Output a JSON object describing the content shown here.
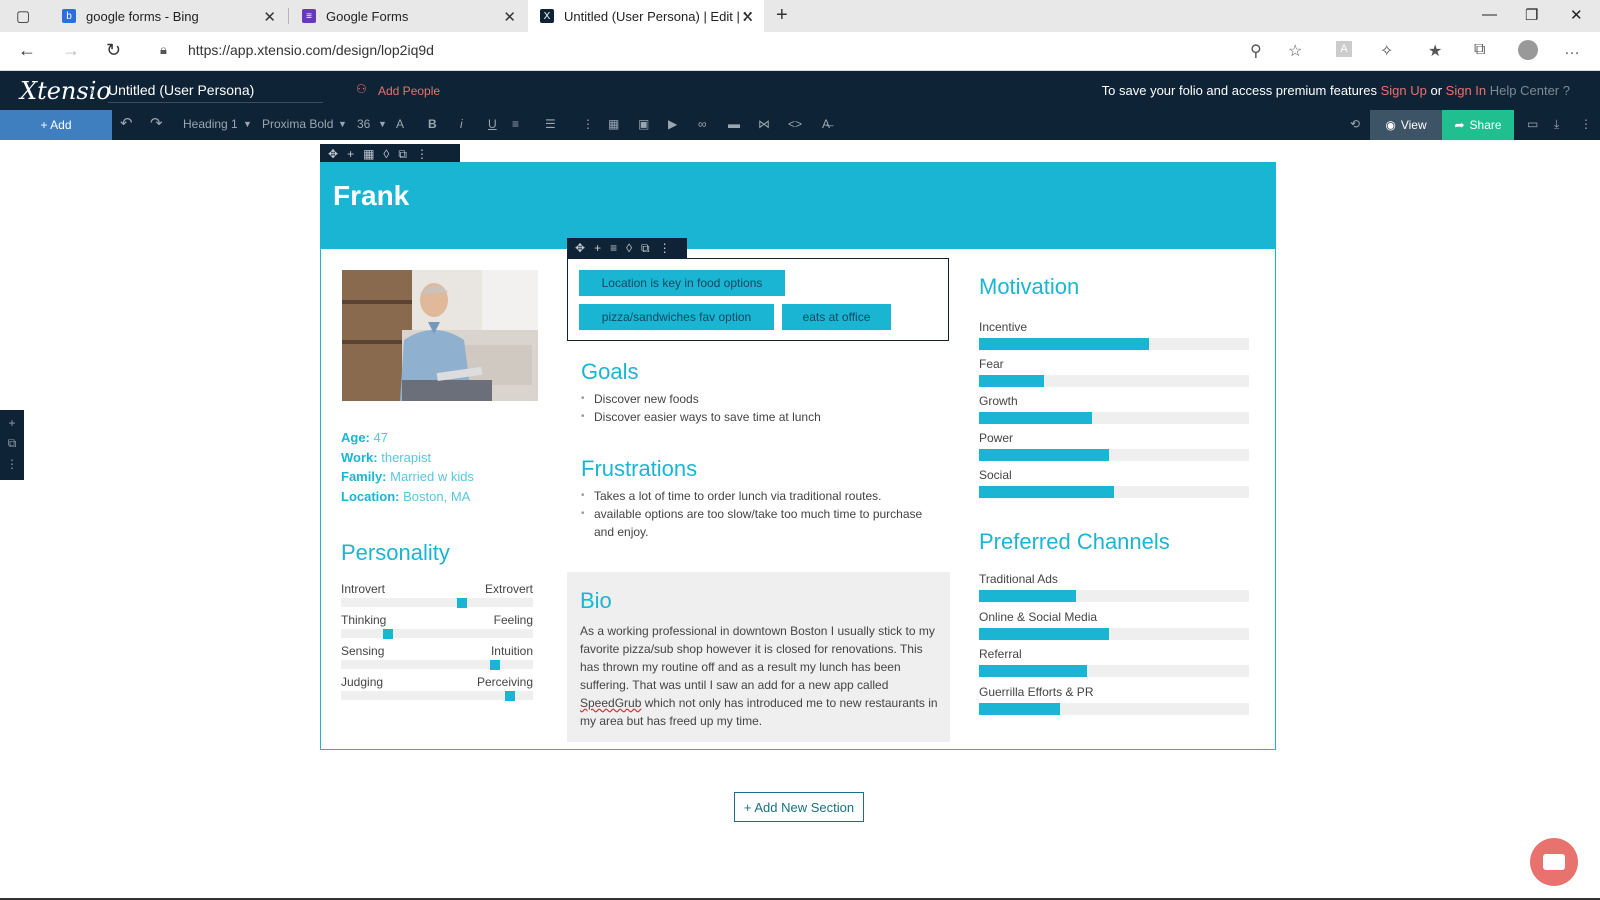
{
  "browser": {
    "tabs": [
      {
        "title": "google forms - Bing",
        "fav_color": "#2a6fdb"
      },
      {
        "title": "Google Forms",
        "fav_color": "#673ab7"
      },
      {
        "title": "Untitled (User Persona) | Edit | Xt",
        "fav_color": "#0e2336"
      }
    ],
    "url": "https://app.xtensio.com/design/lop2iq9d"
  },
  "app": {
    "logo": "Xtensio",
    "doc_title": "Untitled (User Persona)",
    "add_people": "Add People",
    "promo_text": "To save your folio and access premium features",
    "sign_up": "Sign Up",
    "or": "or",
    "sign_in": "Sign In",
    "help": "Help Center"
  },
  "toolbar": {
    "add": "+ Add",
    "style": "Heading 1",
    "font": "Proxima Bold",
    "size": "36",
    "view": "View",
    "share": "Share"
  },
  "persona": {
    "name": "Frank",
    "details": [
      {
        "label": "Age:",
        "value": "47"
      },
      {
        "label": "Work:",
        "value": "therapist"
      },
      {
        "label": "Family:",
        "value": "Married w kids"
      },
      {
        "label": "Location:",
        "value": "Boston, MA"
      }
    ],
    "tags": [
      "Location is key in food options",
      "pizza/sandwiches fav option",
      "eats at office"
    ],
    "goals_title": "Goals",
    "goals": [
      "Discover new foods",
      "Discover easier ways to save time at lunch"
    ],
    "frustrations_title": "Frustrations",
    "frustrations": [
      "Takes a lot of time to order lunch via traditional routes.",
      "available options are too slow/take too much time to purchase and enjoy."
    ],
    "personality_title": "Personality",
    "personality": [
      {
        "left": "Introvert",
        "right": "Extrovert",
        "position": 0.64
      },
      {
        "left": "Thinking",
        "right": "Feeling",
        "position": 0.23
      },
      {
        "left": "Sensing",
        "right": "Intuition",
        "position": 0.82
      },
      {
        "left": "Judging",
        "right": "Perceiving",
        "position": 0.9
      }
    ],
    "bio_title": "Bio",
    "bio_before": "As a working professional in downtown Boston I usually stick to my favorite pizza/sub shop however it is closed for renovations. This has thrown my routine off and as a result my lunch has been suffering. That was until I saw an add for a new app called ",
    "bio_speedgrub": "SpeedGrub",
    "bio_after": " which not only has introduced me to new restaurants in my area but has freed up my time.",
    "motivation_title": "Motivation",
    "motivation": [
      {
        "label": "Incentive",
        "value": 0.63
      },
      {
        "label": "Fear",
        "value": 0.24
      },
      {
        "label": "Growth",
        "value": 0.42
      },
      {
        "label": "Power",
        "value": 0.48
      },
      {
        "label": "Social",
        "value": 0.5
      }
    ],
    "channels_title": "Preferred Channels",
    "channels": [
      {
        "label": "Traditional Ads",
        "value": 0.36
      },
      {
        "label": "Online & Social Media",
        "value": 0.48
      },
      {
        "label": "Referral",
        "value": 0.4
      },
      {
        "label": "Guerrilla Efforts & PR",
        "value": 0.3
      }
    ]
  },
  "add_section": "+ Add New Section"
}
